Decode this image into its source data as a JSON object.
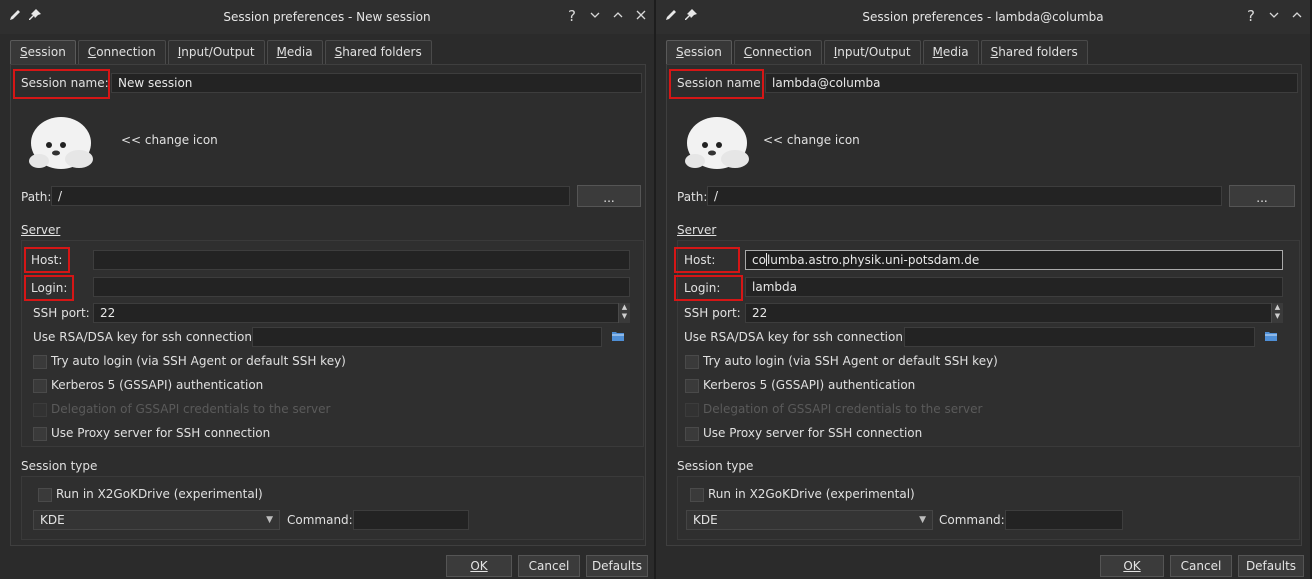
{
  "windows": [
    {
      "title": "Session preferences - New session",
      "tabs": [
        {
          "pre": "",
          "u": "S",
          "post": "ession"
        },
        {
          "pre": "",
          "u": "C",
          "post": "onnection"
        },
        {
          "pre": "",
          "u": "I",
          "post": "nput/Output"
        },
        {
          "pre": "",
          "u": "M",
          "post": "edia"
        },
        {
          "pre": "",
          "u": "S",
          "post": "hared folders"
        }
      ],
      "session_name_label": "Session name:",
      "session_name_value": "New session",
      "change_icon": "<< change icon",
      "path_label": "Path:",
      "path_value": "/",
      "path_button": "...",
      "server_heading": "Server",
      "host_label": "Host:",
      "host_value_before": "",
      "host_value_after": "",
      "login_label": "Login:",
      "login_value": "",
      "ssh_port_label": "SSH port:",
      "ssh_port_value": "22",
      "rsa_label": "Use RSA/DSA key for ssh connection:",
      "rsa_value": "",
      "auto_login": "Try auto login (via SSH Agent or default SSH key)",
      "kerberos": "Kerberos 5 (GSSAPI) authentication",
      "delegation": "Delegation of GSSAPI credentials to the server",
      "proxy": "Use Proxy server for SSH connection",
      "session_type_heading": "Session type",
      "x2godrive": "Run in X2GoKDrive (experimental)",
      "session_type_value": "KDE",
      "command_label": "Command:",
      "command_value": "",
      "ok": "OK",
      "cancel": "Cancel",
      "defaults": "Defaults"
    },
    {
      "title": "Session preferences - lambda@columba",
      "tabs": [
        {
          "pre": "",
          "u": "S",
          "post": "ession"
        },
        {
          "pre": "",
          "u": "C",
          "post": "onnection"
        },
        {
          "pre": "",
          "u": "I",
          "post": "nput/Output"
        },
        {
          "pre": "",
          "u": "M",
          "post": "edia"
        },
        {
          "pre": "",
          "u": "S",
          "post": "hared folders"
        }
      ],
      "session_name_label": "Session name:",
      "session_name_value": "lambda@columba",
      "change_icon": "<< change icon",
      "path_label": "Path:",
      "path_value": "/",
      "path_button": "...",
      "server_heading": "Server",
      "host_label": "Host:",
      "host_value_before": "co",
      "host_value_after": "lumba.astro.physik.uni-potsdam.de",
      "login_label": "Login:",
      "login_value": "lambda",
      "ssh_port_label": "SSH port:",
      "ssh_port_value": "22",
      "rsa_label": "Use RSA/DSA key for ssh connection:",
      "rsa_value": "",
      "auto_login": "Try auto login (via SSH Agent or default SSH key)",
      "kerberos": "Kerberos 5 (GSSAPI) authentication",
      "delegation": "Delegation of GSSAPI credentials to the server",
      "proxy": "Use Proxy server for SSH connection",
      "session_type_heading": "Session type",
      "x2godrive": "Run in X2GoKDrive (experimental)",
      "session_type_value": "KDE",
      "command_label": "Command:",
      "command_value": "",
      "ok": "OK",
      "cancel": "Cancel",
      "defaults": "Defaults"
    }
  ],
  "title_buttons": [
    "?",
    "⌄",
    "⌃",
    "✕"
  ],
  "accent": "#d51616"
}
